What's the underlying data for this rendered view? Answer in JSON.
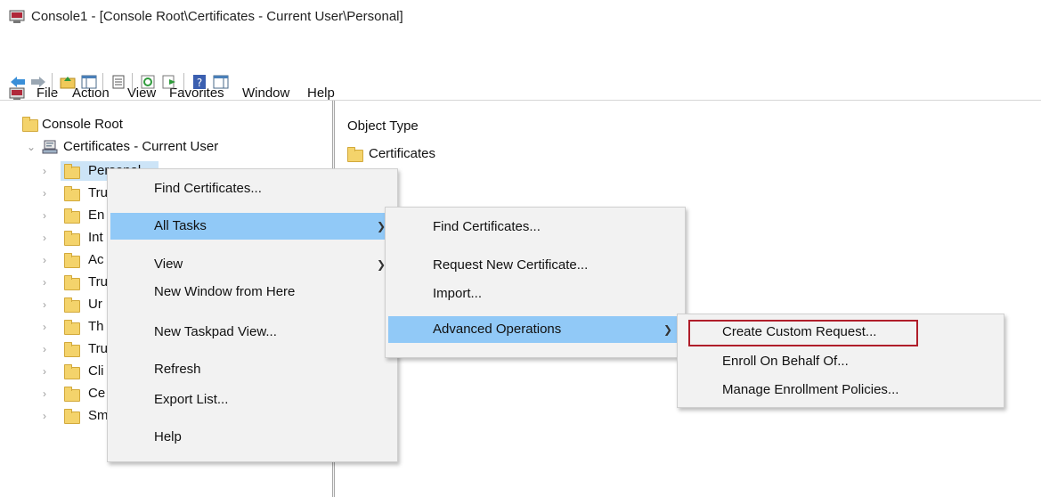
{
  "window": {
    "title": "Console1 - [Console Root\\Certificates - Current User\\Personal]"
  },
  "menubar": {
    "items": [
      "File",
      "Action",
      "View",
      "Favorites",
      "Window",
      "Help"
    ]
  },
  "toolbar": {
    "buttons": [
      "back-icon",
      "forward-icon",
      "up-folder-icon",
      "show-hide-tree-icon",
      "properties-icon",
      "refresh-icon",
      "export-list-icon",
      "help-icon",
      "show-hide-action-pane-icon"
    ]
  },
  "tree": {
    "root": "Console Root",
    "store": "Certificates - Current User",
    "children": [
      "Personal",
      "Tru",
      "En",
      "Int",
      "Ac",
      "Tru",
      "Ur",
      "Th",
      "Tru",
      "Cli",
      "Ce",
      "Sm"
    ]
  },
  "details": {
    "column_header": "Object Type",
    "items": [
      "Certificates"
    ]
  },
  "context_menu": {
    "items": [
      "Find Certificates...",
      "All Tasks",
      "View",
      "New Window from Here",
      "New Taskpad View...",
      "Refresh",
      "Export List...",
      "Help"
    ]
  },
  "all_tasks_menu": {
    "items": [
      "Find Certificates...",
      "Request New Certificate...",
      "Import...",
      "Advanced Operations"
    ]
  },
  "advanced_menu": {
    "items": [
      "Create Custom Request...",
      "Enroll On Behalf Of...",
      "Manage Enrollment Policies..."
    ]
  },
  "colors": {
    "highlight": "#91c9f7",
    "annotation_box": "#b01e2a",
    "menu_bg": "#f2f2f2"
  }
}
